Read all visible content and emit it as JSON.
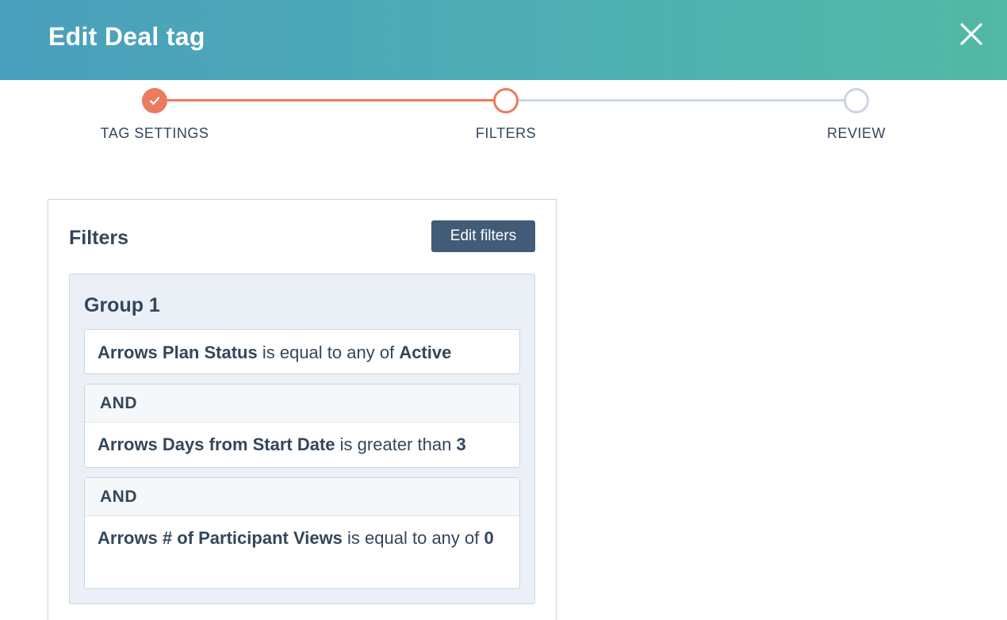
{
  "header": {
    "title": "Edit Deal tag",
    "close_icon": "close-icon"
  },
  "stepper": {
    "steps": [
      {
        "label": "TAG SETTINGS",
        "state": "done"
      },
      {
        "label": "FILTERS",
        "state": "active"
      },
      {
        "label": "REVIEW",
        "state": "todo"
      }
    ]
  },
  "filters": {
    "title": "Filters",
    "edit_button": "Edit filters",
    "group": {
      "title": "Group 1",
      "conditions": [
        {
          "connector": "",
          "property": "Arrows Plan Status",
          "operator": "is equal to any of",
          "value": "Active"
        },
        {
          "connector": "AND",
          "property": "Arrows Days from Start Date",
          "operator": "is greater than",
          "value": "3"
        },
        {
          "connector": "AND",
          "property": "Arrows # of Participant Views",
          "operator": "is equal to any of",
          "value": "0"
        }
      ]
    }
  },
  "colors": {
    "accent": "#ea7b5f",
    "header_start": "#4a9fbc",
    "header_end": "#52b9a5",
    "button": "#425b76",
    "text": "#33475b",
    "inactive": "#cbd6e2"
  }
}
